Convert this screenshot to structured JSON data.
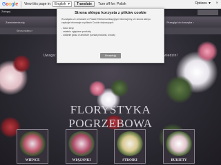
{
  "translate_bar": {
    "logo": "Google",
    "view_text": "View this page in:",
    "language": "English",
    "translate_label": "Translate",
    "turn_off_label": "Turn off for: Polish",
    "options_label": "Options ▼",
    "close": "×"
  },
  "site": {
    "top_left": "Zaloguj",
    "nav": [
      "Zamówienia się",
      "Kontakt",
      "Oferta",
      "Regulamin",
      "Przegląd do koszyka ›"
    ],
    "subnav": "Strona sklepu ›",
    "warning": "Uwaga: Przedstawiona nieaktualna. Aktualna oferta – Zapraszamy do odwiedzin!",
    "title": "FLORYSTYKA POGRZEBOWA",
    "categories": [
      "WIĄZANKI",
      "WIĄZANKI",
      "STROIKI",
      "BUKIETY"
    ],
    "first_category": "WIENCE"
  },
  "cookie_modal": {
    "title": "Strona sklepu korzysta z plików cookie",
    "intro": "W związku ze zmianami w Prawie Telekomunikacyjnym informujemy, że strona sklepu zapisuje informacje w plikach Cookie dotyczących:",
    "items": [
      "- Ilości sesji",
      "- ostatnio oglądane produkty",
      "- oddanie głosu w ankiecie (sonda produktu, wroda)"
    ],
    "button": "Akceptuję"
  }
}
